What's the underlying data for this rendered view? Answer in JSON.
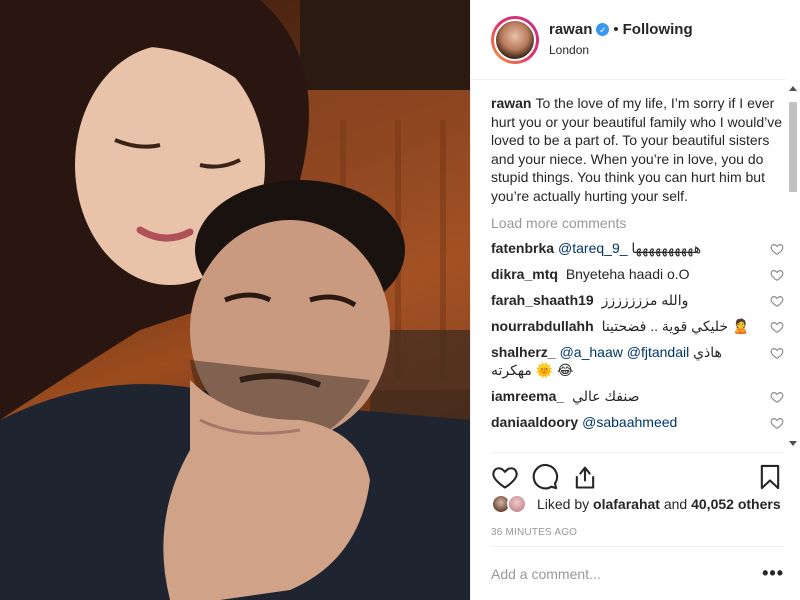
{
  "post": {
    "username": "rawan",
    "following_label": "Following",
    "location": "London",
    "caption_user": "rawan",
    "caption_text": "To the love of my life, I’m sorry if I ever hurt you or your beautiful family who I would’ve loved to be a part of. To your beautiful sisters and your niece. When you’re in love, you do stupid things. You think you can hurt him but you’re actually hurting your self.",
    "load_more": "Load more comments"
  },
  "comments": [
    {
      "user": "fatenbrka",
      "mention": "@tareq_9_",
      "text": "هههههههههها"
    },
    {
      "user": "dikra_mtq",
      "mention": "",
      "text": "Bnyeteha haadi o.O"
    },
    {
      "user": "farah_shaath19",
      "mention": "",
      "text": "والله مززززززز"
    },
    {
      "user": "nourrabdullahh",
      "mention": "",
      "text": "خليكي قوية .. فضحتينا 🙎"
    },
    {
      "user": "shalherz_",
      "mention": "@a_haaw @fjtandail",
      "text": "هاذي مهكرته 🌞 😂"
    },
    {
      "user": "iamreema_",
      "mention": "",
      "text": "صنفك عالي"
    },
    {
      "user": "daniaaldoory",
      "mention": "@sabaahmeed",
      "text": ""
    }
  ],
  "likes": {
    "prefix": "Liked by",
    "first_user": "olafarahat",
    "middle": "and",
    "others": "40,052 others"
  },
  "timestamp": "36 MINUTES AGO",
  "add_comment": {
    "placeholder": "Add a comment..."
  },
  "more_label": "•••",
  "colors": {
    "link": "#003569",
    "verified": "#3897f0",
    "muted": "#999999"
  },
  "icons": [
    "heart-icon",
    "comment-icon",
    "share-icon",
    "bookmark-icon",
    "verified-badge-icon",
    "more-options-icon"
  ]
}
